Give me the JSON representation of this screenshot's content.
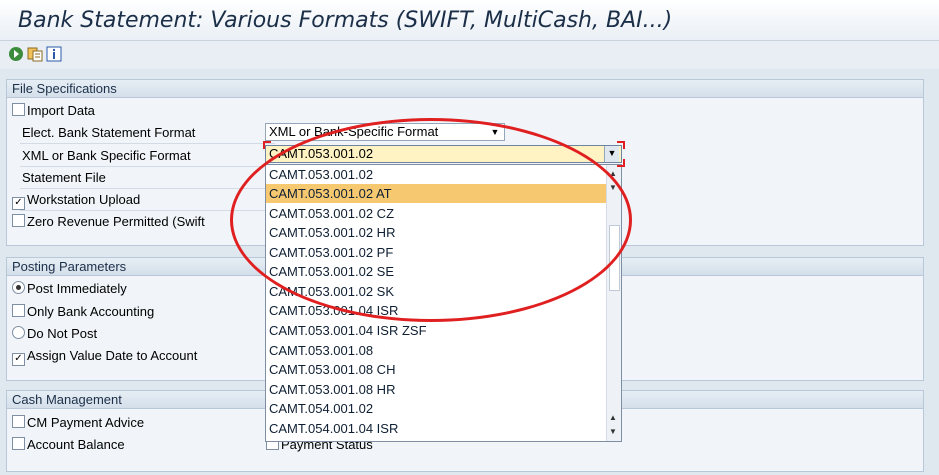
{
  "window": {
    "title": "Bank Statement: Various Formats (SWIFT, MultiCash, BAI...)"
  },
  "toolbar": {
    "icons": [
      "execute-icon",
      "variant-icon",
      "info-icon"
    ]
  },
  "file_spec": {
    "header": "File Specifications",
    "import_data": "Import Data",
    "import_data_checked": false,
    "format_label": "Elect. Bank Statement Format",
    "format_value": "XML or Bank-Specific Format",
    "xml_label": "XML or Bank Specific Format",
    "xml_value": "CAMT.053.001.02",
    "statement_file_label": "Statement File",
    "workstation_upload": "Workstation Upload",
    "workstation_upload_checked": true,
    "zero_revenue": "Zero Revenue Permitted (Swift",
    "zero_revenue_checked": false
  },
  "dropdown": {
    "items": [
      "CAMT.053.001.02",
      "CAMT.053.001.02 AT",
      "CAMT.053.001.02 CZ",
      "CAMT.053.001.02 HR",
      "CAMT.053.001.02 PF",
      "CAMT.053.001.02 SE",
      "CAMT.053.001.02 SK",
      "CAMT.053.001.04 ISR",
      "CAMT.053.001.04 ISR ZSF",
      "CAMT.053.001.08",
      "CAMT.053.001.08 CH",
      "CAMT.053.001.08 HR",
      "CAMT.054.001.02",
      "CAMT.054.001.04 ISR"
    ],
    "selected": "CAMT.053.001.02 AT"
  },
  "posting": {
    "header": "Posting Parameters",
    "post_immediately": "Post Immediately",
    "post_immediately_selected": true,
    "only_bank_accounting": "Only Bank Accounting",
    "only_bank_accounting_checked": false,
    "do_not_post": "Do Not Post",
    "do_not_post_selected": false,
    "assign_value_date": "Assign Value Date to Account",
    "assign_value_date_checked": true
  },
  "cash_mgmt": {
    "header": "Cash Management",
    "cm_payment_advice": "CM Payment Advice",
    "account_balance": "Account Balance",
    "payment_status": "Payment Status"
  },
  "colors": {
    "highlight": "#f6c970",
    "annotation": "#e02020",
    "active_field": "#fff3c4"
  }
}
